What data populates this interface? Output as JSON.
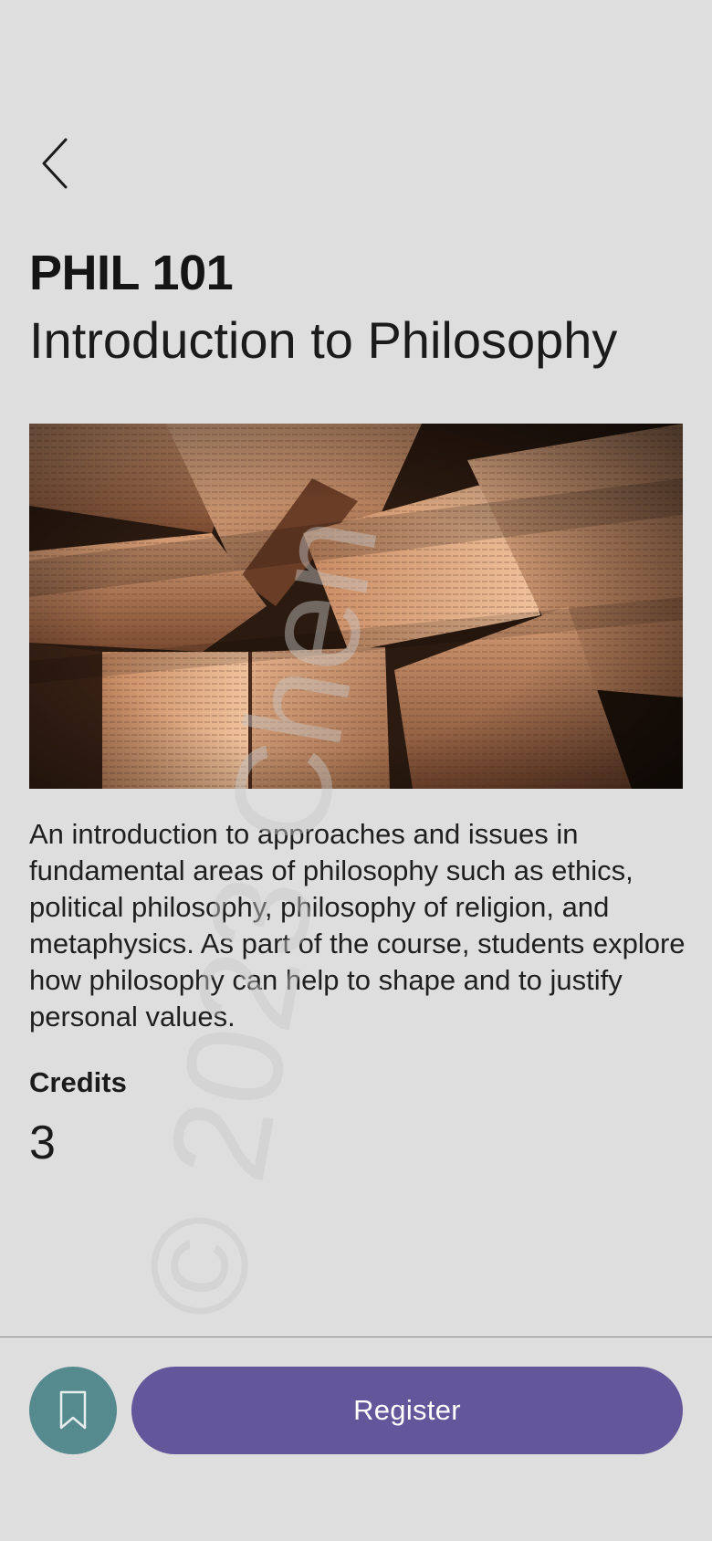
{
  "header": {
    "back_icon": "chevron-left-icon"
  },
  "course": {
    "code": "PHIL 101",
    "title": "Introduction to Philosophy",
    "image_icon": "open-books-photo",
    "description": "An introduction to approaches and issues in fundamental areas of philosophy such as ethics, political philosophy, philosophy of religion, and metaphysics. As part of the course, students explore how philosophy can help to shape and to justify personal values.",
    "credits_label": "Credits",
    "credits_value": "3"
  },
  "watermark": {
    "text": "© 2023 Chen"
  },
  "actions": {
    "bookmark_icon": "bookmark-icon",
    "register_label": "Register"
  },
  "colors": {
    "background": "#dedede",
    "bookmark_button": "#558a8f",
    "register_button": "#63569a",
    "text": "#1b1b1b"
  }
}
